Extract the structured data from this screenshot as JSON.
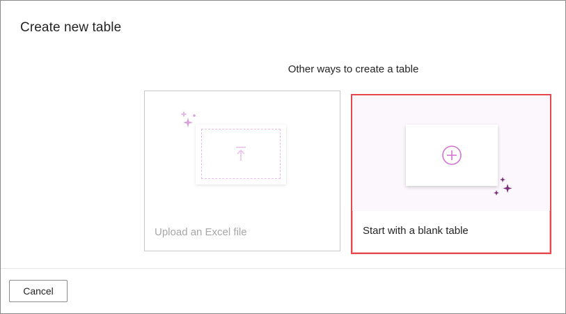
{
  "dialog": {
    "title": "Create new table",
    "subtitle": "Other ways to create a table"
  },
  "options": {
    "upload": {
      "label": "Upload an Excel file",
      "icon": "upload-arrow-icon",
      "state": "disabled"
    },
    "blank": {
      "label": "Start with a blank table",
      "icon": "plus-circle-icon",
      "state": "highlighted"
    }
  },
  "footer": {
    "cancel_label": "Cancel"
  },
  "colors": {
    "accent": "#d473d4",
    "sparkle_light": "#d8a3d8",
    "sparkle_dark": "#7a2d7a",
    "highlight_border": "#e5484d",
    "disabled_text": "#a7a7a7"
  }
}
